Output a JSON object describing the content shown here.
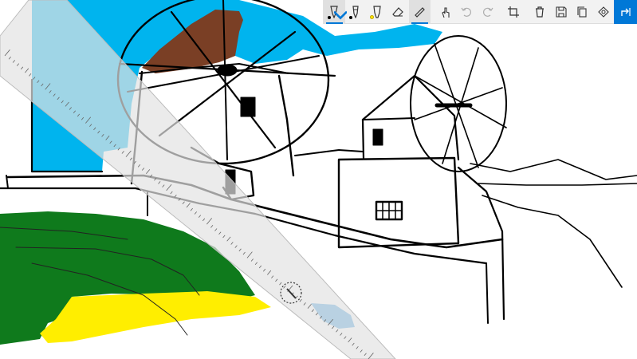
{
  "app": {
    "window_title": "",
    "accent_color": "#0078d7"
  },
  "toolbar": {
    "tools": [
      {
        "name": "ballpoint-pen",
        "icon": "pen-icon",
        "color": "#000000",
        "selected": true
      },
      {
        "name": "pencil",
        "icon": "pencil-icon",
        "color": "#000000",
        "selected": false
      },
      {
        "name": "highlighter",
        "icon": "highlighter-icon",
        "color": "#ffe600",
        "selected": false
      },
      {
        "name": "eraser",
        "icon": "eraser-icon",
        "selected": false
      },
      {
        "name": "ruler",
        "icon": "ruler-icon",
        "selected": true
      },
      {
        "name": "touch-writing",
        "icon": "touch-writing-icon",
        "selected": false
      },
      {
        "name": "undo",
        "icon": "undo-icon",
        "enabled": false
      },
      {
        "name": "redo",
        "icon": "redo-icon",
        "enabled": false
      },
      {
        "name": "crop",
        "icon": "crop-icon"
      },
      {
        "name": "clear-all",
        "icon": "trash-icon"
      },
      {
        "name": "save",
        "icon": "save-icon"
      },
      {
        "name": "copy",
        "icon": "copy-icon"
      },
      {
        "name": "share-ink",
        "icon": "share-circle-icon"
      },
      {
        "name": "share",
        "icon": "share-icon"
      }
    ]
  },
  "ruler": {
    "angle_readout": "",
    "protractor_icon": "compass-dial-icon"
  },
  "drawing": {
    "colors": {
      "sky": "#00b4ee",
      "roof": "#7a3f25",
      "grass": "#0f7a1c",
      "sand": "#ffee00",
      "sea": "#58a8e0",
      "ink": "#000000",
      "ruler": "#e2e2e2"
    }
  }
}
